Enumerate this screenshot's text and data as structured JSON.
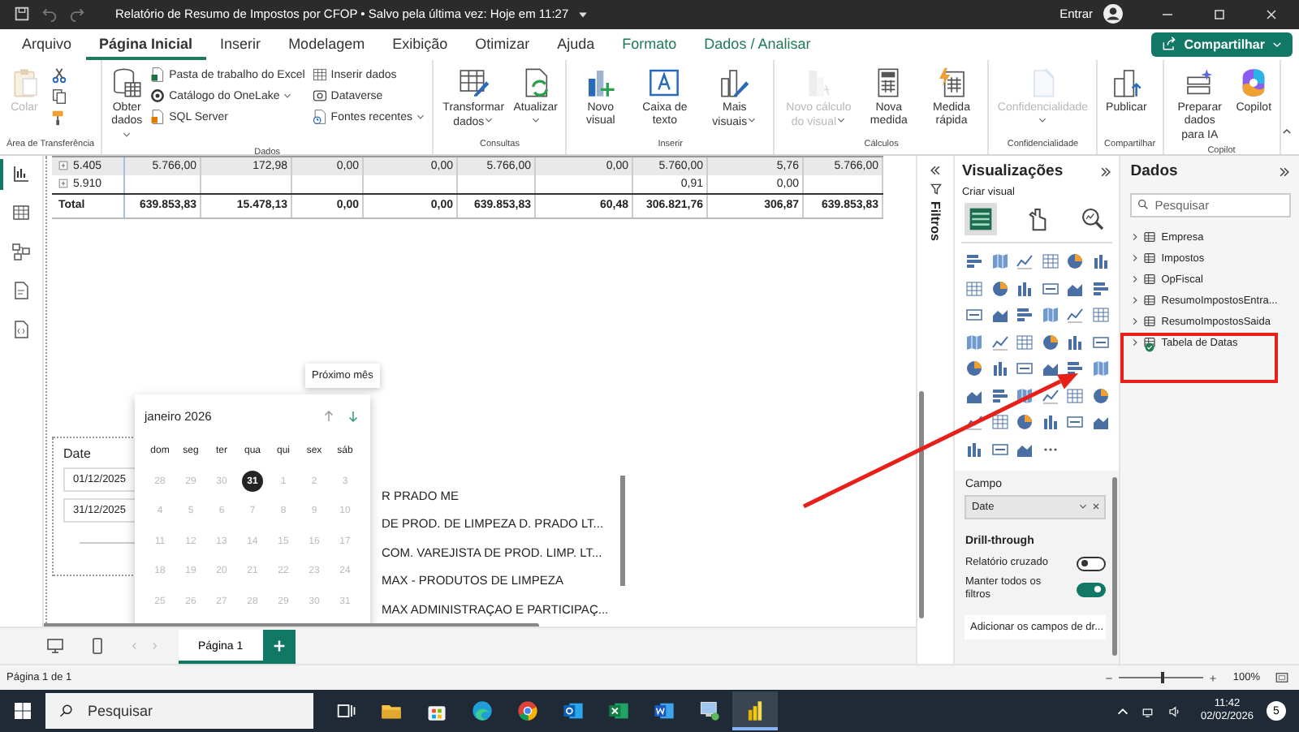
{
  "title_bar": {
    "title": "Relatório de Resumo de Impostos por CFOP • Salvo pela última vez: Hoje em 11:27",
    "sign_in": "Entrar"
  },
  "tabs": [
    {
      "label": "Arquivo",
      "selected": false,
      "kind": "standard"
    },
    {
      "label": "Página Inicial",
      "selected": true,
      "kind": "standard"
    },
    {
      "label": "Inserir",
      "selected": false,
      "kind": "standard"
    },
    {
      "label": "Modelagem",
      "selected": false,
      "kind": "standard"
    },
    {
      "label": "Exibição",
      "selected": false,
      "kind": "standard"
    },
    {
      "label": "Otimizar",
      "selected": false,
      "kind": "standard"
    },
    {
      "label": "Ajuda",
      "selected": false,
      "kind": "standard"
    },
    {
      "label": "Formato",
      "selected": false,
      "kind": "contextual"
    },
    {
      "label": "Dados / Analisar",
      "selected": false,
      "kind": "contextual"
    }
  ],
  "share_button": {
    "label": "Compartilhar"
  },
  "ribbon": [
    {
      "label": "Área de Transferência",
      "items": [
        {
          "kind": "paste",
          "label": "Colar",
          "disabled": true
        },
        {
          "kind": "cut",
          "disabled": false
        },
        {
          "kind": "copy",
          "disabled": false
        },
        {
          "kind": "brush",
          "disabled": false
        }
      ]
    },
    {
      "label": "Dados",
      "items": [
        {
          "kind": "database",
          "label": "Obter dados",
          "disabled": false,
          "dropdown": true
        },
        {
          "kind": "excel",
          "label": "Pasta de trabalho do Excel",
          "disabled": false
        },
        {
          "kind": "onelake",
          "label": "Catálogo do OneLake",
          "disabled": false,
          "dropdown": true
        },
        {
          "kind": "sql",
          "label": "SQL Server",
          "disabled": false
        },
        {
          "kind": "table",
          "label": "Inserir dados",
          "disabled": false
        },
        {
          "kind": "dataverse",
          "label": "Dataverse",
          "disabled": false
        },
        {
          "kind": "recent",
          "label": "Fontes recentes",
          "disabled": false,
          "dropdown": true
        }
      ]
    },
    {
      "label": "Consultas",
      "items": [
        {
          "kind": "transform",
          "label": "Transformar dados",
          "disabled": false,
          "dropdown": true
        },
        {
          "kind": "refresh",
          "label": "Atualizar",
          "disabled": false,
          "dropdown": true
        }
      ]
    },
    {
      "label": "Inserir",
      "items": [
        {
          "kind": "visual",
          "label": "Novo visual",
          "disabled": false
        },
        {
          "kind": "textbox",
          "label": "Caixa de texto",
          "disabled": false
        },
        {
          "kind": "morevisuals",
          "label": "Mais visuais",
          "disabled": false,
          "dropdown": true
        }
      ]
    },
    {
      "label": "Cálculos",
      "items": [
        {
          "kind": "calc",
          "label": "Novo cálculo do visual",
          "disabled": true,
          "dropdown": true
        },
        {
          "kind": "measure",
          "label": "Nova medida",
          "disabled": false
        },
        {
          "kind": "quickmeasure",
          "label": "Medida rápida",
          "disabled": false
        }
      ]
    },
    {
      "label": "Confidencialidade",
      "items": [
        {
          "kind": "sensitivity",
          "label": "Confidencialidade",
          "disabled": true,
          "dropdown": true
        }
      ]
    },
    {
      "label": "Compartilhar",
      "items": [
        {
          "kind": "publish",
          "label": "Publicar",
          "disabled": false
        }
      ]
    },
    {
      "label": "Copilot",
      "items": [
        {
          "kind": "prepare",
          "label": "Preparar dados para IA",
          "disabled": false
        },
        {
          "kind": "copilot",
          "label": "Copilot",
          "disabled": false
        }
      ]
    }
  ],
  "left_rail": [
    {
      "kind": "report",
      "selected": true
    },
    {
      "kind": "grid",
      "selected": false
    },
    {
      "kind": "model",
      "selected": false
    },
    {
      "kind": "dax",
      "selected": false
    },
    {
      "kind": "tmdl",
      "selected": false
    }
  ],
  "table": {
    "rows": [
      {
        "label": "5.405",
        "kind": "group",
        "selected": true,
        "cells": [
          "5.766,00",
          "172,98",
          "0,00",
          "0,00",
          "5.766,00",
          "0,00",
          "5.760,00",
          "5,76",
          "5.766,00"
        ]
      },
      {
        "label": "5.910",
        "kind": "group",
        "selected": false,
        "cells": [
          null,
          null,
          null,
          null,
          null,
          null,
          "0,91",
          "0,00",
          null
        ]
      },
      {
        "label": "Total",
        "kind": "total",
        "selected": false,
        "cells": [
          "639.853,83",
          "15.478,13",
          "0,00",
          "0,00",
          "639.853,83",
          "60,48",
          "306.821,76",
          "306,87",
          "639.853,83"
        ]
      }
    ]
  },
  "slicer": {
    "title": "Date",
    "start": "01/12/2025",
    "end": "31/12/2025"
  },
  "calendar": {
    "month": "janeiro 2026",
    "weekdays": [
      "dom",
      "seg",
      "ter",
      "qua",
      "qui",
      "sex",
      "sáb"
    ],
    "days": [
      {
        "label": "28",
        "selected": false
      },
      {
        "label": "29",
        "selected": false
      },
      {
        "label": "30",
        "selected": false
      },
      {
        "label": "31",
        "selected": true
      },
      {
        "label": "1",
        "selected": false
      },
      {
        "label": "2",
        "selected": false
      },
      {
        "label": "3",
        "selected": false
      },
      {
        "label": "4",
        "selected": false
      },
      {
        "label": "5",
        "selected": false
      },
      {
        "label": "6",
        "selected": false
      },
      {
        "label": "7",
        "selected": false
      },
      {
        "label": "8",
        "selected": false
      },
      {
        "label": "9",
        "selected": false
      },
      {
        "label": "10",
        "selected": false
      },
      {
        "label": "11",
        "selected": false
      },
      {
        "label": "12",
        "selected": false
      },
      {
        "label": "13",
        "selected": false
      },
      {
        "label": "14",
        "selected": false
      },
      {
        "label": "15",
        "selected": false
      },
      {
        "label": "16",
        "selected": false
      },
      {
        "label": "17",
        "selected": false
      },
      {
        "label": "18",
        "selected": false
      },
      {
        "label": "19",
        "selected": false
      },
      {
        "label": "20",
        "selected": false
      },
      {
        "label": "21",
        "selected": false
      },
      {
        "label": "22",
        "selected": false
      },
      {
        "label": "23",
        "selected": false
      },
      {
        "label": "24",
        "selected": false
      },
      {
        "label": "25",
        "selected": false
      },
      {
        "label": "26",
        "selected": false
      },
      {
        "label": "27",
        "selected": false
      },
      {
        "label": "28",
        "selected": false
      },
      {
        "label": "29",
        "selected": false
      },
      {
        "label": "30",
        "selected": false
      },
      {
        "label": "31",
        "selected": false
      }
    ]
  },
  "tooltip": "Próximo mês",
  "list_visual": [
    "R PRADO ME",
    "DE PROD. DE LIMPEZA D. PRADO LT...",
    "COM. VAREJISTA DE PROD. LIMP. LT...",
    "MAX - PRODUTOS DE LIMPEZA",
    "MAX ADMINISTRAÇAO E PARTICIPAÇ..."
  ],
  "filters": {
    "label": "Filtros"
  },
  "visualizations": {
    "title": "Visualizações",
    "subtitle": "Criar visual",
    "modes": [
      {
        "kind": "build",
        "selected": true
      },
      {
        "kind": "format",
        "selected": false
      },
      {
        "kind": "analytics",
        "selected": false
      }
    ],
    "field_label": "Campo",
    "field": "Date",
    "drill_title": "Drill-through",
    "toggles": [
      {
        "label": "Relatório cruzado",
        "on": false
      },
      {
        "label": "Manter todos os filtros",
        "on": true
      }
    ],
    "drop_placeholder": "Adicionar os campos de dr..."
  },
  "data_pane": {
    "title": "Dados",
    "search_placeholder": "Pesquisar",
    "tables": [
      {
        "label": "Empresa",
        "expanded": false,
        "in_use": false
      },
      {
        "label": "Impostos",
        "expanded": false,
        "in_use": false
      },
      {
        "label": "OpFiscal",
        "expanded": false,
        "in_use": false
      },
      {
        "label": "ResumoImpostosEntra...",
        "expanded": false,
        "in_use": false
      },
      {
        "label": "ResumoImpostosSaida",
        "expanded": false,
        "in_use": false
      },
      {
        "label": "Tabela de Datas",
        "expanded": false,
        "in_use": true
      }
    ]
  },
  "page_tabs": [
    {
      "label": "Página 1",
      "selected": true
    }
  ],
  "status_bar": {
    "page": "Página 1 de 1",
    "zoom": "100%",
    "level": 0.5
  },
  "taskbar": {
    "search_placeholder": "Pesquisar",
    "time": "11:42",
    "date": "02/02/2026",
    "notifications": "5",
    "apps": [
      {
        "kind": "taskview",
        "selected": false
      },
      {
        "kind": "explorer",
        "selected": false
      },
      {
        "kind": "store",
        "selected": false
      },
      {
        "kind": "edge",
        "selected": false
      },
      {
        "kind": "chrome",
        "selected": false
      },
      {
        "kind": "outlook",
        "selected": false
      },
      {
        "kind": "excel",
        "selected": false
      },
      {
        "kind": "word",
        "selected": false
      },
      {
        "kind": "remote",
        "selected": false
      },
      {
        "kind": "powerbi",
        "selected": true
      }
    ]
  }
}
